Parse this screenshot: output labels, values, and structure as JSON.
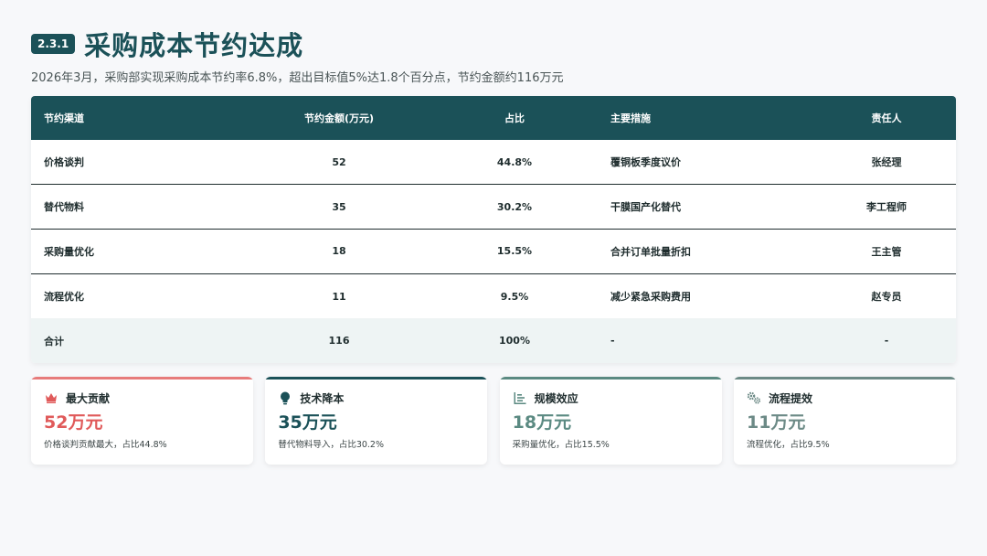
{
  "header": {
    "section_badge": "2.3.1",
    "title": "采购成本节约达成",
    "subtitle": "2026年3月，采购部实现采购成本节约率6.8%，超出目标值5%达1.8个百分点，节约金额约116万元"
  },
  "table": {
    "columns": [
      "节约渠道",
      "节约金额(万元)",
      "占比",
      "主要措施",
      "责任人"
    ],
    "rows": [
      [
        "价格谈判",
        "52",
        "44.8%",
        "覆铜板季度议价",
        "张经理"
      ],
      [
        "替代物料",
        "35",
        "30.2%",
        "干膜国产化替代",
        "李工程师"
      ],
      [
        "采购量优化",
        "18",
        "15.5%",
        "合并订单批量折扣",
        "王主管"
      ],
      [
        "流程优化",
        "11",
        "9.5%",
        "减少紧急采购费用",
        "赵专员"
      ]
    ],
    "total": [
      "合计",
      "116",
      "100%",
      "-",
      "-"
    ]
  },
  "cards": [
    {
      "icon": "crown-icon",
      "label": "最大贡献",
      "value": "52万元",
      "desc": "价格谈判贡献最大，占比44.8%",
      "color": "#e05a5a"
    },
    {
      "icon": "lightbulb-icon",
      "label": "技术降本",
      "value": "35万元",
      "desc": "替代物料导入，占比30.2%",
      "color": "#1b5158"
    },
    {
      "icon": "bar-list-icon",
      "label": "规模效应",
      "value": "18万元",
      "desc": "采购量优化，占比15.5%",
      "color": "#5b8a82"
    },
    {
      "icon": "gears-icon",
      "label": "流程提效",
      "value": "11万元",
      "desc": "流程优化，占比9.5%",
      "color": "#6c8a86"
    }
  ],
  "colors": {
    "primary": "#1b5158",
    "accent_red": "#e05a5a",
    "background": "#f7f8fa"
  }
}
